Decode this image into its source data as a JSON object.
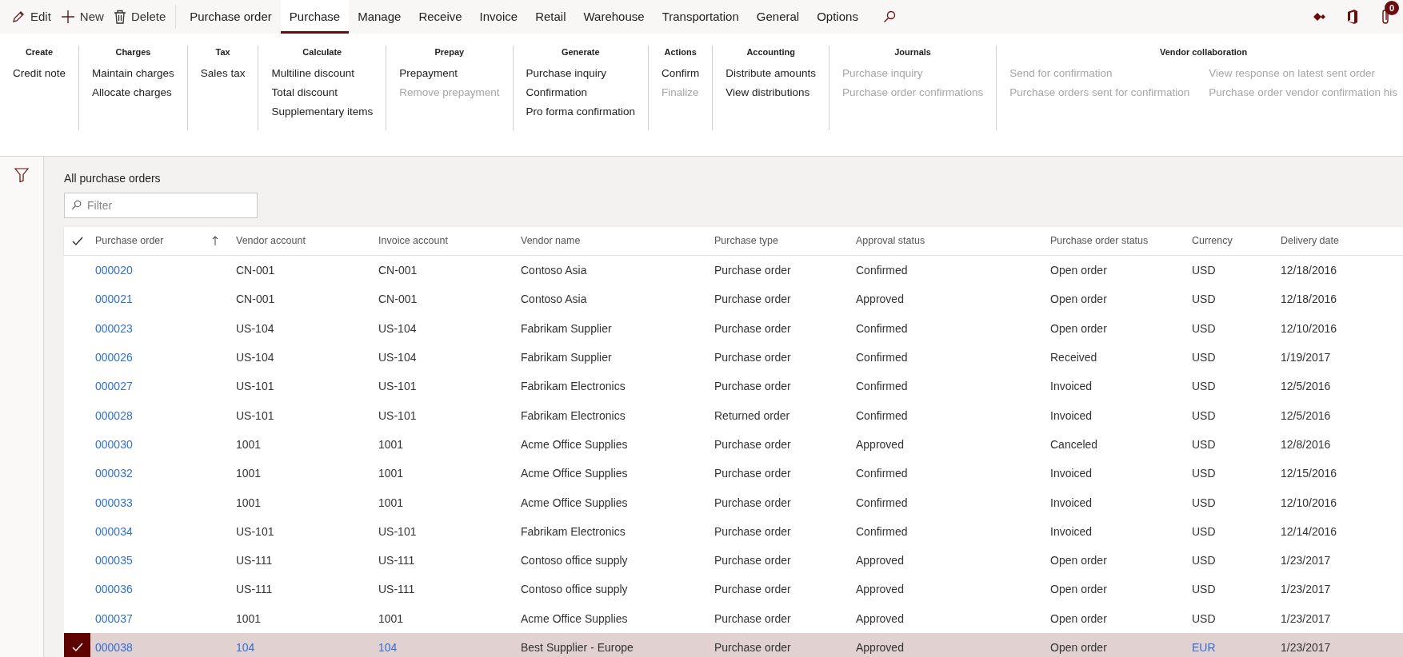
{
  "toolbar": {
    "actions": [
      {
        "kind": "edit",
        "label": "Edit"
      },
      {
        "kind": "new",
        "label": "New"
      },
      {
        "kind": "delete",
        "label": "Delete"
      }
    ],
    "tabs": [
      {
        "label": "Purchase order",
        "selected": false
      },
      {
        "label": "Purchase",
        "selected": true
      },
      {
        "label": "Manage",
        "selected": false
      },
      {
        "label": "Receive",
        "selected": false
      },
      {
        "label": "Invoice",
        "selected": false
      },
      {
        "label": "Retail",
        "selected": false
      },
      {
        "label": "Warehouse",
        "selected": false
      },
      {
        "label": "Transportation",
        "selected": false
      },
      {
        "label": "General",
        "selected": false
      },
      {
        "label": "Options",
        "selected": false
      }
    ],
    "attachments_badge": "0"
  },
  "ribbon": {
    "groups": [
      {
        "title": "Create",
        "columns": [
          [
            {
              "label": "Credit note",
              "disabled": false
            }
          ]
        ]
      },
      {
        "title": "Charges",
        "columns": [
          [
            {
              "label": "Maintain charges",
              "disabled": false
            },
            {
              "label": "Allocate charges",
              "disabled": false
            }
          ]
        ]
      },
      {
        "title": "Tax",
        "columns": [
          [
            {
              "label": "Sales tax",
              "disabled": false
            }
          ]
        ]
      },
      {
        "title": "Calculate",
        "columns": [
          [
            {
              "label": "Multiline discount",
              "disabled": false
            },
            {
              "label": "Total discount",
              "disabled": false
            },
            {
              "label": "Supplementary items",
              "disabled": false
            }
          ]
        ]
      },
      {
        "title": "Prepay",
        "columns": [
          [
            {
              "label": "Prepayment",
              "disabled": false
            },
            {
              "label": "Remove prepayment",
              "disabled": true
            }
          ]
        ]
      },
      {
        "title": "Generate",
        "columns": [
          [
            {
              "label": "Purchase inquiry",
              "disabled": false
            },
            {
              "label": "Confirmation",
              "disabled": false
            },
            {
              "label": "Pro forma confirmation",
              "disabled": false
            }
          ]
        ]
      },
      {
        "title": "Actions",
        "columns": [
          [
            {
              "label": "Confirm",
              "disabled": false
            },
            {
              "label": "Finalize",
              "disabled": true
            }
          ]
        ]
      },
      {
        "title": "Accounting",
        "columns": [
          [
            {
              "label": "Distribute amounts",
              "disabled": false
            },
            {
              "label": "View distributions",
              "disabled": false
            }
          ]
        ]
      },
      {
        "title": "Journals",
        "columns": [
          [
            {
              "label": "Purchase inquiry",
              "disabled": true
            },
            {
              "label": "Purchase order confirmations",
              "disabled": true
            }
          ]
        ]
      },
      {
        "title": "Vendor collaboration",
        "columns": [
          [
            {
              "label": "Send for confirmation",
              "disabled": true
            },
            {
              "label": "Purchase orders sent for confirmation",
              "disabled": true
            }
          ],
          [
            {
              "label": "View response on latest sent order",
              "disabled": true
            },
            {
              "label": "Purchase order vendor confirmation his",
              "disabled": true
            }
          ]
        ]
      }
    ]
  },
  "list": {
    "title": "All purchase orders",
    "filter": {
      "placeholder": "Filter"
    },
    "columns": [
      "Purchase order",
      "Vendor account",
      "Invoice account",
      "Vendor name",
      "Purchase type",
      "Approval status",
      "Purchase order status",
      "Currency",
      "Delivery date"
    ],
    "rows": [
      {
        "cells": [
          "000020",
          "CN-001",
          "CN-001",
          "Contoso Asia",
          "Purchase order",
          "Confirmed",
          "Open order",
          "USD",
          "12/18/2016"
        ],
        "selected": false,
        "linked": false
      },
      {
        "cells": [
          "000021",
          "CN-001",
          "CN-001",
          "Contoso Asia",
          "Purchase order",
          "Approved",
          "Open order",
          "USD",
          "12/18/2016"
        ],
        "selected": false,
        "linked": false
      },
      {
        "cells": [
          "000023",
          "US-104",
          "US-104",
          "Fabrikam Supplier",
          "Purchase order",
          "Confirmed",
          "Open order",
          "USD",
          "12/10/2016"
        ],
        "selected": false,
        "linked": false
      },
      {
        "cells": [
          "000026",
          "US-104",
          "US-104",
          "Fabrikam Supplier",
          "Purchase order",
          "Confirmed",
          "Received",
          "USD",
          "1/19/2017"
        ],
        "selected": false,
        "linked": false
      },
      {
        "cells": [
          "000027",
          "US-101",
          "US-101",
          "Fabrikam Electronics",
          "Purchase order",
          "Confirmed",
          "Invoiced",
          "USD",
          "12/5/2016"
        ],
        "selected": false,
        "linked": false
      },
      {
        "cells": [
          "000028",
          "US-101",
          "US-101",
          "Fabrikam Electronics",
          "Returned order",
          "Confirmed",
          "Invoiced",
          "USD",
          "12/5/2016"
        ],
        "selected": false,
        "linked": false
      },
      {
        "cells": [
          "000030",
          "1001",
          "1001",
          "Acme Office Supplies",
          "Purchase order",
          "Approved",
          "Canceled",
          "USD",
          "12/8/2016"
        ],
        "selected": false,
        "linked": false
      },
      {
        "cells": [
          "000032",
          "1001",
          "1001",
          "Acme Office Supplies",
          "Purchase order",
          "Confirmed",
          "Invoiced",
          "USD",
          "12/15/2016"
        ],
        "selected": false,
        "linked": false
      },
      {
        "cells": [
          "000033",
          "1001",
          "1001",
          "Acme Office Supplies",
          "Purchase order",
          "Confirmed",
          "Invoiced",
          "USD",
          "12/10/2016"
        ],
        "selected": false,
        "linked": false
      },
      {
        "cells": [
          "000034",
          "US-101",
          "US-101",
          "Fabrikam Electronics",
          "Purchase order",
          "Confirmed",
          "Invoiced",
          "USD",
          "12/14/2016"
        ],
        "selected": false,
        "linked": false
      },
      {
        "cells": [
          "000035",
          "US-111",
          "US-111",
          "Contoso office supply",
          "Purchase order",
          "Approved",
          "Open order",
          "USD",
          "1/23/2017"
        ],
        "selected": false,
        "linked": false
      },
      {
        "cells": [
          "000036",
          "US-111",
          "US-111",
          "Contoso office supply",
          "Purchase order",
          "Approved",
          "Open order",
          "USD",
          "1/23/2017"
        ],
        "selected": false,
        "linked": false
      },
      {
        "cells": [
          "000037",
          "1001",
          "1001",
          "Acme Office Supplies",
          "Purchase order",
          "Approved",
          "Open order",
          "USD",
          "1/23/2017"
        ],
        "selected": false,
        "linked": false
      },
      {
        "cells": [
          "000038",
          "104",
          "104",
          "Best Supplier - Europe",
          "Purchase order",
          "Approved",
          "Open order",
          "EUR",
          "1/23/2017"
        ],
        "selected": true,
        "linked": true
      }
    ]
  }
}
